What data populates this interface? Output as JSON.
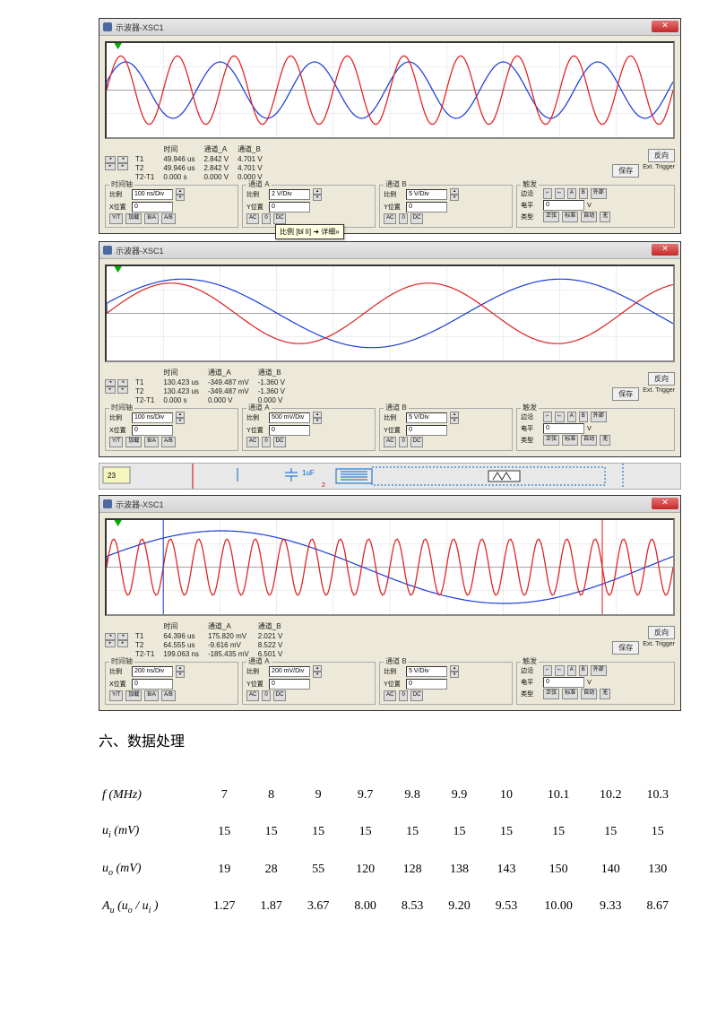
{
  "scopes": [
    {
      "title": "示波器-XSC1",
      "readout": {
        "rows": [
          "T1",
          "T2",
          "T2-T1"
        ],
        "cols": [
          "时间",
          "通道_A",
          "通道_B"
        ],
        "vals": [
          [
            "49.946 us",
            "2.842 V",
            "4.701 V"
          ],
          [
            "49.946 us",
            "2.842 V",
            "4.701 V"
          ],
          [
            "0.000 s",
            "0.000 V",
            "0.000 V"
          ]
        ]
      },
      "btns": {
        "reverse": "反向",
        "save": "保存",
        "ext": "Ext. Trigger"
      },
      "timebase": {
        "hdr": "时间轴",
        "scale_lbl": "比例",
        "scale": "100 ns/Div",
        "pos_lbl": "X位置",
        "pos": "0",
        "row3": [
          "Y/T",
          "加载",
          "B/A",
          "A/B"
        ]
      },
      "chanA": {
        "hdr": "通道 A",
        "scale_lbl": "比例",
        "scale": "2 V/Div",
        "pos_lbl": "Y位置",
        "pos": "0",
        "row3": [
          "AC",
          "0",
          "DC"
        ]
      },
      "chanB": {
        "hdr": "通道 B",
        "scale_lbl": "比例",
        "scale": "5 V/Div",
        "pos_lbl": "Y位置",
        "pos": "0",
        "row3": [
          "AC",
          "0",
          "DC"
        ]
      },
      "trigger": {
        "hdr": "触发",
        "edge_lbl": "边沿",
        "level_lbl": "电平",
        "level": "0",
        "type_lbl": "类型",
        "types": [
          "正弦",
          "标准",
          "自动",
          "无"
        ]
      },
      "tooltip": "比例 [bǐ lì]  ➜ 详细»",
      "waves": {
        "blueFreq": 6,
        "redFreq": 10,
        "blueAmp": 0.7,
        "redAmp": 0.85
      }
    },
    {
      "title": "示波器-XSC1",
      "readout": {
        "rows": [
          "T1",
          "T2",
          "T2-T1"
        ],
        "cols": [
          "时间",
          "通道_A",
          "通道_B"
        ],
        "vals": [
          [
            "130.423 us",
            "-349.487 mV",
            "-1.360 V"
          ],
          [
            "130.423 us",
            "-349.487 mV",
            "-1.360 V"
          ],
          [
            "0.000 s",
            "0.000 V",
            "0.000 V"
          ]
        ]
      },
      "btns": {
        "reverse": "反向",
        "save": "保存",
        "ext": "Ext. Trigger"
      },
      "timebase": {
        "hdr": "时间轴",
        "scale_lbl": "比例",
        "scale": "100 ns/Div",
        "pos_lbl": "X位置",
        "pos": "0",
        "row3": [
          "Y/T",
          "加载",
          "B/A",
          "A/B"
        ]
      },
      "chanA": {
        "hdr": "通道 A",
        "scale_lbl": "比例",
        "scale": "500 mV/Div",
        "pos_lbl": "Y位置",
        "pos": "0",
        "row3": [
          "AC",
          "0",
          "DC"
        ]
      },
      "chanB": {
        "hdr": "通道 B",
        "scale_lbl": "比例",
        "scale": "5 V/Div",
        "pos_lbl": "Y位置",
        "pos": "0",
        "row3": [
          "AC",
          "0",
          "DC"
        ]
      },
      "trigger": {
        "hdr": "触发",
        "edge_lbl": "边沿",
        "level_lbl": "电平",
        "level": "0",
        "type_lbl": "类型",
        "types": [
          "正弦",
          "标准",
          "自动",
          "无"
        ]
      },
      "waves": {
        "blueFreq": 1.5,
        "redFreq": 2.2,
        "blueAmp": 0.85,
        "redAmp": 0.75
      }
    },
    {
      "title": "示波器-XSC1",
      "readout": {
        "rows": [
          "T1",
          "T2",
          "T2-T1"
        ],
        "cols": [
          "时间",
          "通道_A",
          "通道_B"
        ],
        "vals": [
          [
            "64.396 us",
            "175.820 mV",
            "2.021 V"
          ],
          [
            "64.555 us",
            "-9.616 mV",
            "8.522 V"
          ],
          [
            "199.063 ns",
            "-185.435 mV",
            "6.501 V"
          ]
        ]
      },
      "btns": {
        "reverse": "反向",
        "save": "保存",
        "ext": "Ext. Trigger"
      },
      "timebase": {
        "hdr": "时间轴",
        "scale_lbl": "比例",
        "scale": "200 ns/Div",
        "pos_lbl": "X位置",
        "pos": "0",
        "row3": [
          "Y/T",
          "加载",
          "B/A",
          "A/B"
        ]
      },
      "chanA": {
        "hdr": "通道 A",
        "scale_lbl": "比例",
        "scale": "200 mV/Div",
        "pos_lbl": "Y位置",
        "pos": "0",
        "row3": [
          "AC",
          "0",
          "DC"
        ]
      },
      "chanB": {
        "hdr": "通道 B",
        "scale_lbl": "比例",
        "scale": "5 V/Div",
        "pos_lbl": "Y位置",
        "pos": "0",
        "row3": [
          "AC",
          "0",
          "DC"
        ]
      },
      "trigger": {
        "hdr": "触发",
        "edge_lbl": "边沿",
        "level_lbl": "电平",
        "level": "0",
        "type_lbl": "类型",
        "types": [
          "正弦",
          "标准",
          "自动",
          "无"
        ]
      },
      "waves": {
        "blueFreq": 1,
        "redFreq": 20,
        "blueAmp": 0.9,
        "redAmp": 0.7
      }
    }
  ],
  "circuit_label": "1uF",
  "section_title": "六、数据处理",
  "chart_data": {
    "type": "table",
    "rows": [
      {
        "label": "f (MHz)",
        "values": [
          "7",
          "8",
          "9",
          "9.7",
          "9.8",
          "9.9",
          "10",
          "10.1",
          "10.2",
          "10.3"
        ]
      },
      {
        "label": "uᵢ (mV)",
        "values": [
          "15",
          "15",
          "15",
          "15",
          "15",
          "15",
          "15",
          "15",
          "15",
          "15"
        ]
      },
      {
        "label": "uₒ (mV)",
        "values": [
          "19",
          "28",
          "55",
          "120",
          "128",
          "138",
          "143",
          "150",
          "140",
          "130"
        ]
      },
      {
        "label": "Aᵤ (uₒ / uᵢ)",
        "values": [
          "1.27",
          "1.87",
          "3.67",
          "8.00",
          "8.53",
          "9.20",
          "9.53",
          "10.00",
          "9.33",
          "8.67"
        ]
      }
    ]
  },
  "table_labels": {
    "r0": "<i>f</i> (<i>MHz</i>)",
    "r1": "<i>u<span class='sub'>i</span></i> (<i>mV</i>)",
    "r2": "<i>u<span class='sub'>o</span></i> (<i>mV</i>)",
    "r3": "<i>A<span class='sub'>u</span></i> (<i>u<span class='sub'>o</span></i> / <i>u<span class='sub'>i</span></i> )"
  }
}
